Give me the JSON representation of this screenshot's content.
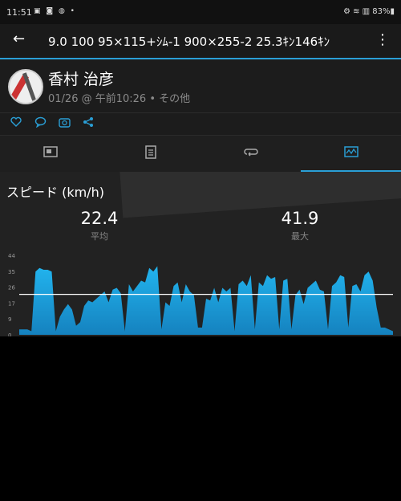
{
  "status_bar": {
    "time": "11:51",
    "icons_left": "▣ ◙ ◍ •",
    "right": "⚙ ≋ ▥ 83%▮"
  },
  "app_bar": {
    "title": "9.0 100 95×115+ｼﾑ-1 900×255-2 25.3ｷﾝ146ｷﾝ"
  },
  "activity": {
    "user_name": "香村 治彦",
    "meta": "01/26 @ 午前10:26 • その他"
  },
  "tabs": [
    {
      "name": "tab-summary",
      "icon": "summary-icon"
    },
    {
      "name": "tab-details",
      "icon": "document-icon"
    },
    {
      "name": "tab-laps",
      "icon": "loop-icon"
    },
    {
      "name": "tab-charts",
      "icon": "chart-icon",
      "active": true
    }
  ],
  "speed_panel": {
    "title": "スピード (km/h)",
    "avg": {
      "value": "22.4",
      "label": "平均"
    },
    "max": {
      "value": "41.9",
      "label": "最大"
    }
  },
  "chart_data": {
    "type": "area",
    "yticks": [
      "44",
      "35",
      "26",
      "17",
      "9",
      "0"
    ],
    "ylim": [
      0,
      44
    ],
    "avg_line": 22.4,
    "color": "#1e9fd8",
    "values": [
      3,
      3,
      3,
      2,
      35,
      37,
      36,
      36,
      35,
      2,
      10,
      14,
      17,
      14,
      5,
      7,
      16,
      19,
      18,
      20,
      22,
      24,
      18,
      25,
      26,
      23,
      2,
      28,
      24,
      27,
      30,
      29,
      37,
      35,
      38,
      3,
      18,
      16,
      27,
      29,
      18,
      28,
      24,
      22,
      4,
      4,
      20,
      19,
      26,
      18,
      26,
      24,
      26,
      2,
      28,
      30,
      27,
      33,
      3,
      29,
      27,
      33,
      31,
      32,
      3,
      30,
      31,
      3,
      22,
      25,
      17,
      26,
      28,
      30,
      25,
      24,
      3,
      27,
      29,
      33,
      32,
      4,
      27,
      28,
      24,
      33,
      35,
      30,
      15,
      4,
      4,
      3,
      2
    ]
  }
}
